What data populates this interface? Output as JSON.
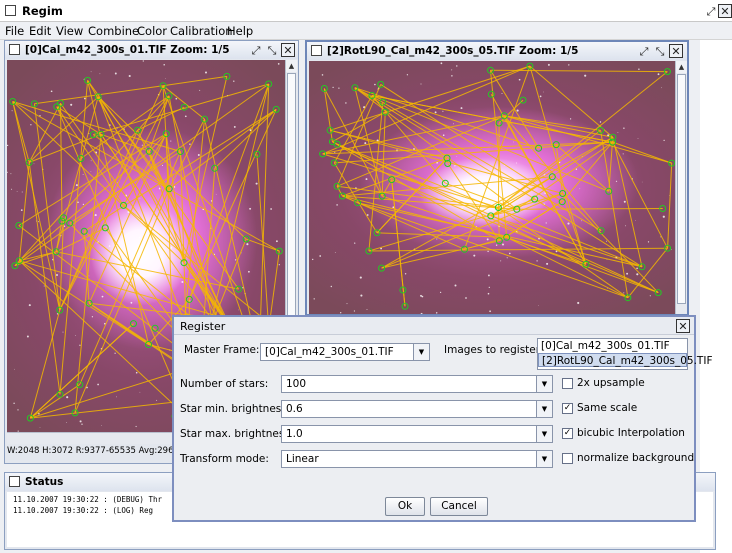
{
  "app": {
    "title": "Regim"
  },
  "menu": [
    "File",
    "Edit",
    "View",
    "Combine",
    "Color",
    "Calibration",
    "Help"
  ],
  "frames": [
    {
      "title": "[0]Cal_m42_300s_01.TIF  Zoom: 1/5",
      "info": "W:2048 H:3072 R:9377-65535 Avg:29638 BG"
    },
    {
      "title": "[2]RotL90_Cal_m42_300s_05.TIF  Zoom: 1/5"
    }
  ],
  "status": {
    "title": "Status",
    "lines": [
      "11.10.2007 19:30:22 : (DEBUG)  Thr",
      "11.10.2007 19:30:22 : (LOG)    Reg"
    ]
  },
  "dialog": {
    "title": "Register",
    "master_frame_label": "Master Frame:",
    "master_frame_value": "[0]Cal_m42_300s_01.TIF",
    "images_to_register_label": "Images to register:",
    "images_to_register": [
      {
        "label": "[0]Cal_m42_300s_01.TIF",
        "selected": false
      },
      {
        "label": "[2]RotL90_Cal_m42_300s_05.TIF",
        "selected": true
      }
    ],
    "fields": [
      {
        "label": "Number of stars:",
        "value": "100"
      },
      {
        "label": "Star min. brightness:",
        "value": "0.6"
      },
      {
        "label": "Star max. brightness:",
        "value": "1.0"
      },
      {
        "label": "Transform mode:",
        "value": "Linear"
      }
    ],
    "options": [
      {
        "label": "2x upsample",
        "checked": false
      },
      {
        "label": "Same scale",
        "checked": true
      },
      {
        "label": "bicubic Interpolation",
        "checked": true
      },
      {
        "label": "normalize background",
        "checked": false
      }
    ],
    "ok_label": "Ok",
    "cancel_label": "Cancel"
  },
  "colors": {
    "nebula": "#b4589a",
    "match_lines": "#f5b800",
    "star_circles": "#22cc22",
    "frame_border_active": "#6d86b8"
  }
}
